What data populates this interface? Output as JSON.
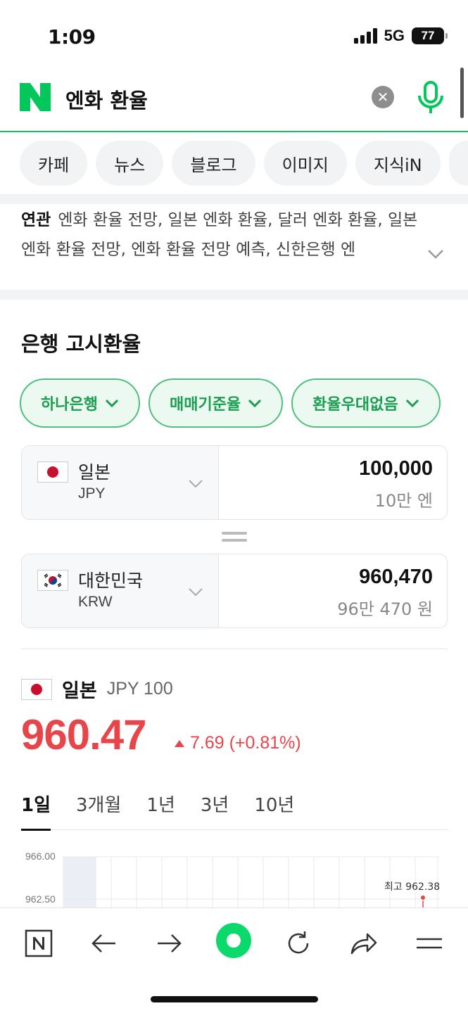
{
  "status": {
    "time": "1:09",
    "network": "5G",
    "battery": "77"
  },
  "search": {
    "query": "엔화 환율"
  },
  "tabs": [
    "카페",
    "뉴스",
    "블로그",
    "이미지",
    "지식iN"
  ],
  "related": {
    "label": "연관",
    "text": "엔화 환율 전망, 일본 엔화 환율, 달러 엔화 환율, 일본 엔화 환율 전망, 엔화 환율 전망 예측, 신한은행 엔"
  },
  "exchange": {
    "title": "은행 고시환율",
    "filters": [
      "하나은행",
      "매매기준율",
      "환율우대없음"
    ],
    "from": {
      "country": "일본",
      "code": "JPY",
      "amount": "100,000",
      "amount_kr": "10만 엔"
    },
    "to": {
      "country": "대한민국",
      "code": "KRW",
      "amount": "960,470",
      "amount_kr": "96만 470 원"
    }
  },
  "rate": {
    "country": "일본",
    "unit": "JPY 100",
    "value": "960.47",
    "change": "7.69 (+0.81%)",
    "color": "#e8454a"
  },
  "periods": [
    "1일",
    "3개월",
    "1년",
    "3년",
    "10년"
  ],
  "chart": {
    "y_labels": [
      "966.00",
      "962.50"
    ],
    "high_label": "최고 962.38"
  },
  "bottom_nav": [
    "naver-home-icon",
    "back-icon",
    "forward-icon",
    "green-dot-icon",
    "refresh-icon",
    "share-icon",
    "menu-icon"
  ]
}
